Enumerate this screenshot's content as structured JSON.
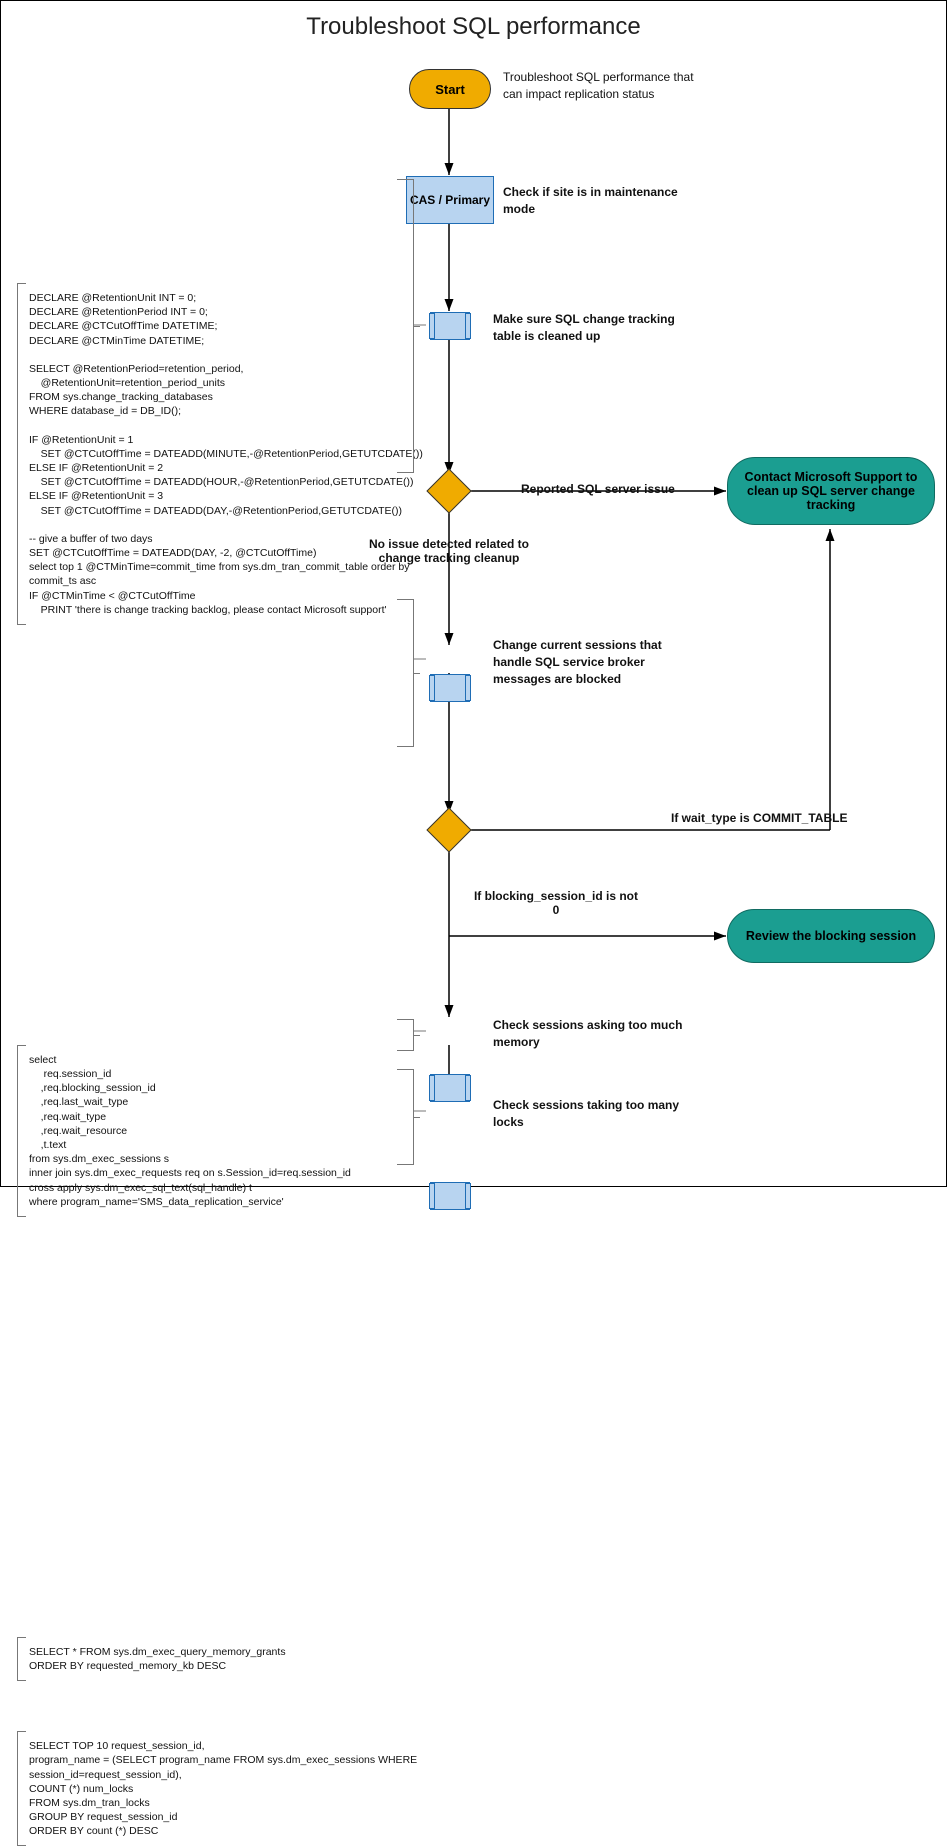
{
  "title": "Troubleshoot SQL performance",
  "nodes": {
    "start": "Start",
    "start_note": "Troubleshoot SQL performance that can impact replication status",
    "cas": "CAS / Primary",
    "cas_note": "Check if site is in maintenance mode",
    "sub1_note": "Make sure SQL change tracking table is cleaned up",
    "d1_right": "Reported SQL server issue",
    "d1_down": "No issue detected related to change tracking cleanup",
    "sub2_note": "Change current sessions that handle SQL service broker messages are blocked",
    "d2_right": "If wait_type is COMMIT_TABLE",
    "d2_down": "If blocking_session_id is not 0",
    "term1": "Contact Microsoft Support to clean up SQL server change tracking",
    "term2": "Review the blocking session",
    "sub3_note": "Check sessions asking too much memory",
    "sub4_note": "Check sessions taking too many locks"
  },
  "code": {
    "block1": "DECLARE @RetentionUnit INT = 0;\nDECLARE @RetentionPeriod INT = 0;\nDECLARE @CTCutOffTime DATETIME;\nDECLARE @CTMinTime DATETIME;\n\nSELECT @RetentionPeriod=retention_period,\n    @RetentionUnit=retention_period_units\nFROM sys.change_tracking_databases\nWHERE database_id = DB_ID();\n\nIF @RetentionUnit = 1\n    SET @CTCutOffTime = DATEADD(MINUTE,-@RetentionPeriod,GETUTCDATE())\nELSE IF @RetentionUnit = 2\n    SET @CTCutOffTime = DATEADD(HOUR,-@RetentionPeriod,GETUTCDATE())\nELSE IF @RetentionUnit = 3\n    SET @CTCutOffTime = DATEADD(DAY,-@RetentionPeriod,GETUTCDATE())\n\n-- give a buffer of two days\nSET @CTCutOffTime = DATEADD(DAY, -2, @CTCutOffTime)\nselect top 1 @CTMinTime=commit_time from sys.dm_tran_commit_table order by\ncommit_ts asc\nIF @CTMinTime < @CTCutOffTime\n    PRINT 'there is change tracking backlog, please contact Microsoft support'",
    "block2": "select\n     req.session_id\n    ,req.blocking_session_id\n    ,req.last_wait_type\n    ,req.wait_type\n    ,req.wait_resource\n    ,t.text\nfrom sys.dm_exec_sessions s\ninner join sys.dm_exec_requests req on s.Session_id=req.session_id\ncross apply sys.dm_exec_sql_text(sql_handle) t\nwhere program_name='SMS_data_replication_service'",
    "block3": "SELECT * FROM sys.dm_exec_query_memory_grants\nORDER BY requested_memory_kb DESC",
    "block4": "SELECT TOP 10 request_session_id,\nprogram_name = (SELECT program_name FROM sys.dm_exec_sessions WHERE\nsession_id=request_session_id),\nCOUNT (*) num_locks\nFROM sys.dm_tran_locks\nGROUP BY request_session_id\nORDER BY count (*) DESC"
  }
}
